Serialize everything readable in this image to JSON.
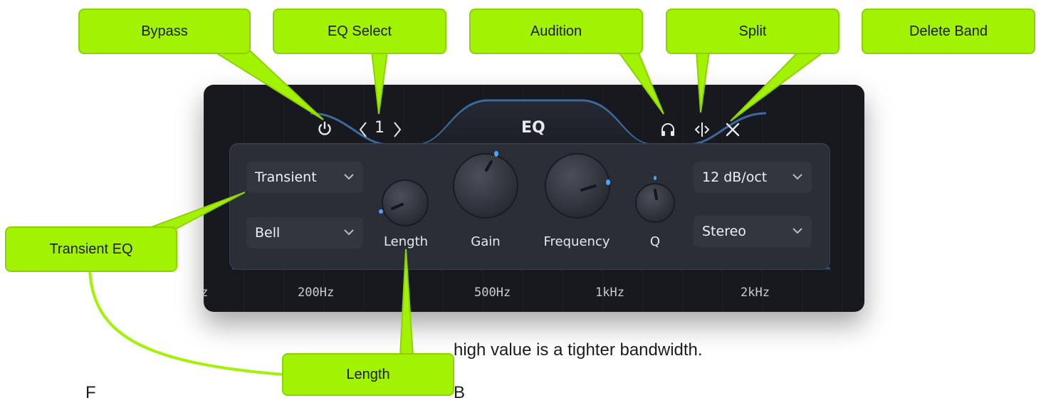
{
  "callouts": {
    "bypass": "Bypass",
    "eq_select": "EQ Select",
    "audition": "Audition",
    "split": "Split",
    "delete_band": "Delete Band",
    "transient_eq": "Transient EQ",
    "length": "Length"
  },
  "plugin": {
    "eq_index": "1",
    "title": "EQ",
    "mode_dropdown": "Transient",
    "shape_dropdown": "Bell",
    "slope_dropdown": "12 dB/oct",
    "stereo_dropdown": "Stereo",
    "knobs": {
      "length": "Length",
      "gain": "Gain",
      "frequency": "Frequency",
      "q": "Q"
    },
    "freq_axis": [
      "z",
      "200Hz",
      "500Hz",
      "1kHz",
      "2kHz"
    ]
  },
  "body_text": {
    "line1": "high value is a tighter bandwidth.",
    "line2_partial": "F",
    "line3_partial": "B"
  },
  "colors": {
    "callout": "#a2f203",
    "accent_blue": "#4fa3ff",
    "panel": "#17191f"
  }
}
